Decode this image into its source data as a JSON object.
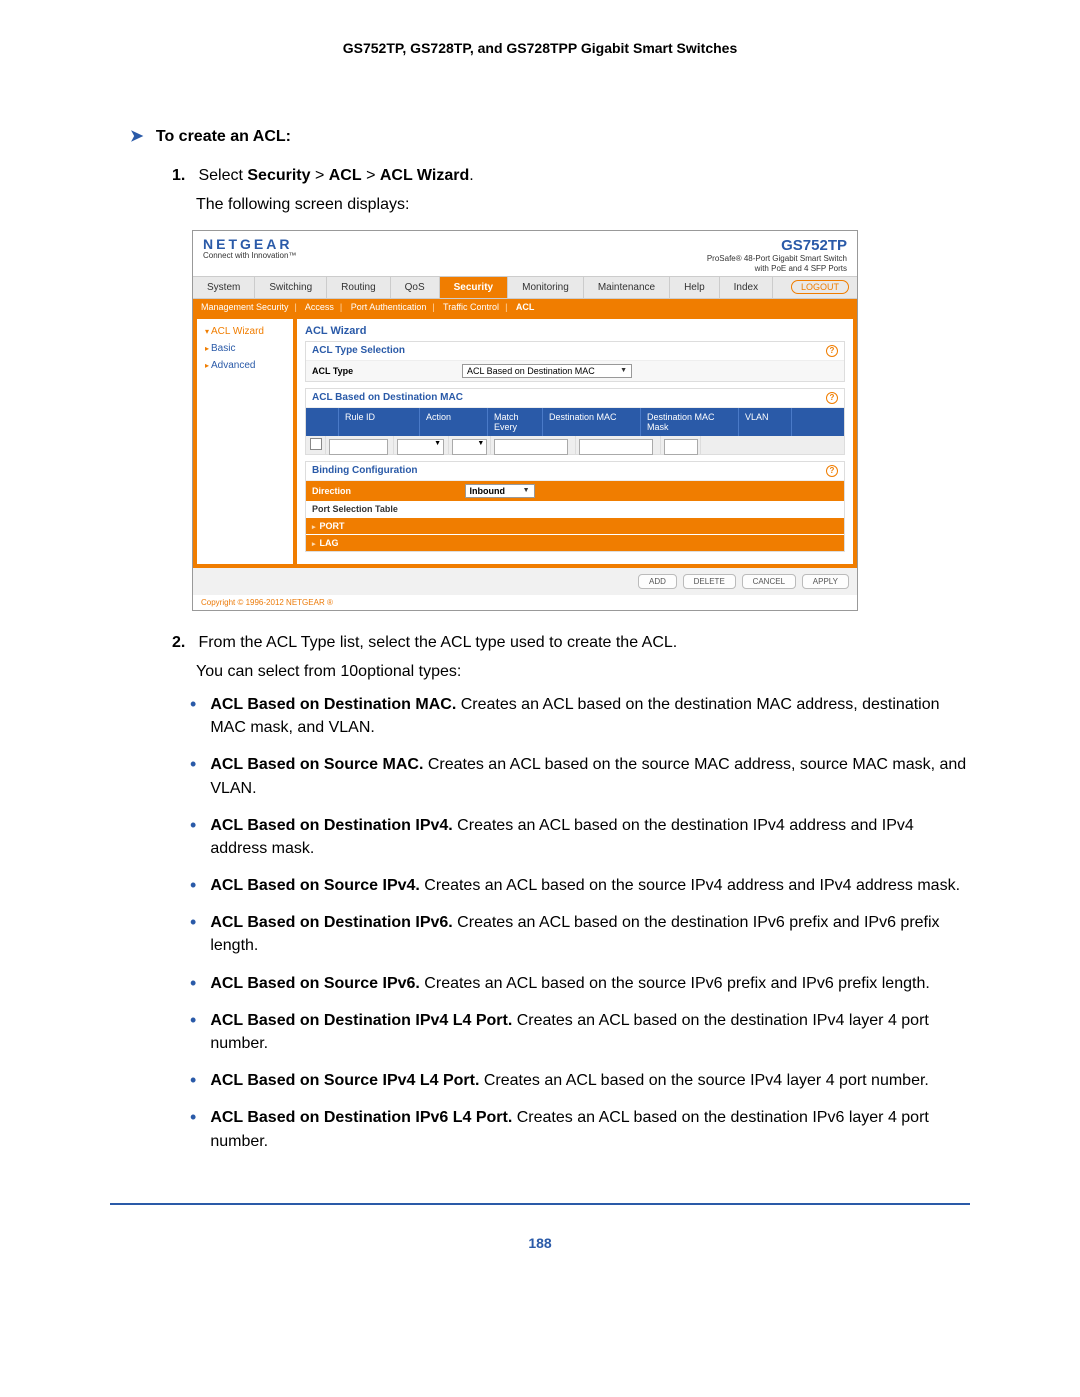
{
  "header": "GS752TP, GS728TP, and GS728TPP Gigabit Smart Switches",
  "heading": "To create an ACL:",
  "step1_prefix": "Select ",
  "step1_path1": "Security",
  "step1_sep": " > ",
  "step1_path2": "ACL",
  "step1_path3": "ACL Wizard",
  "step1_body": "The following screen displays:",
  "screenshot": {
    "logo": "NETGEAR",
    "tagline": "Connect with Innovation™",
    "model": "GS752TP",
    "model_sub1": "ProSafe® 48-Port Gigabit Smart Switch",
    "model_sub2": "with PoE and 4 SFP Ports",
    "tabs": [
      "System",
      "Switching",
      "Routing",
      "QoS",
      "Security",
      "Monitoring",
      "Maintenance",
      "Help",
      "Index"
    ],
    "logout": "LOGOUT",
    "subnav": [
      "Management Security",
      "Access",
      "Port Authentication",
      "Traffic Control",
      "ACL"
    ],
    "side": [
      "ACL Wizard",
      "Basic",
      "Advanced"
    ],
    "main_title": "ACL Wizard",
    "panel1_title": "ACL Type Selection",
    "acl_type_label": "ACL Type",
    "acl_type_value": "ACL Based on Destination MAC",
    "panel2_title": "ACL Based on Destination MAC",
    "cols": [
      "Rule ID",
      "Action",
      "Match Every",
      "Destination MAC",
      "Destination MAC Mask",
      "VLAN"
    ],
    "panel3_title": "Binding Configuration",
    "direction_label": "Direction",
    "direction_value": "Inbound",
    "port_table": "Port Selection Table",
    "port": "PORT",
    "lag": "LAG",
    "buttons": [
      "ADD",
      "DELETE",
      "CANCEL",
      "APPLY"
    ],
    "copyright": "Copyright © 1996-2012 NETGEAR ®"
  },
  "step2_text": "From the ACL Type list, select the ACL type used to create the ACL.",
  "step2_body": "You can select from 10optional types:",
  "bullets": [
    {
      "b": "ACL Based on Destination MAC.",
      "t": " Creates an ACL based on the destination MAC address, destination MAC mask, and VLAN."
    },
    {
      "b": "ACL Based on Source MAC.",
      "t": " Creates an ACL based on the source MAC address, source MAC mask, and VLAN."
    },
    {
      "b": "ACL Based on Destination IPv4.",
      "t": " Creates an ACL based on the destination IPv4 address and IPv4 address mask."
    },
    {
      "b": "ACL Based on Source IPv4.",
      "t": " Creates an ACL based on the source IPv4 address and IPv4 address mask."
    },
    {
      "b": "ACL Based on Destination IPv6.",
      "t": " Creates an ACL based on the destination IPv6 prefix and IPv6 prefix length."
    },
    {
      "b": "ACL Based on Source IPv6.",
      "t": " Creates an ACL based on the source IPv6 prefix and IPv6 prefix length."
    },
    {
      "b": "ACL Based on Destination IPv4 L4 Port.",
      "t": " Creates an ACL based on the destination IPv4 layer 4 port number."
    },
    {
      "b": "ACL Based on Source IPv4 L4 Port.",
      "t": " Creates an ACL based on the source IPv4 layer 4 port number."
    },
    {
      "b": "ACL Based on Destination IPv6 L4 Port.",
      "t": " Creates an ACL based on the destination IPv6 layer 4 port number."
    }
  ],
  "page_num": "188"
}
